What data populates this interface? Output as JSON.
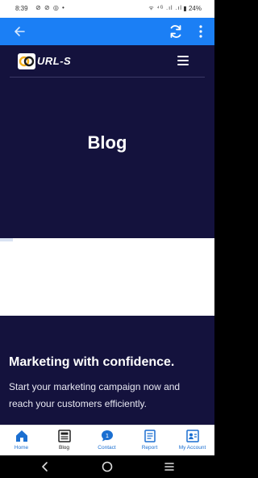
{
  "status_bar": {
    "time": "8:39",
    "left_icons": "⊘ ⊘ ◎ •",
    "right_icons": "ᯤ ⁴ᴳ .ıl .ıl",
    "battery": "▮ 24%"
  },
  "app_bar": {
    "accent": "#1b7ff5",
    "icons": [
      "arrow-left-icon",
      "refresh-icon",
      "more-vertical-icon"
    ]
  },
  "site": {
    "logo_text": "URL-S",
    "hero_title": "Blog",
    "promo": {
      "heading": "Marketing with confidence.",
      "text": "Start your marketing campaign now and reach your customers efficiently."
    },
    "background": "#14123d"
  },
  "bottom_nav": {
    "items": [
      {
        "label": "Home",
        "icon": "home-icon"
      },
      {
        "label": "Blog",
        "icon": "blog-icon"
      },
      {
        "label": "Contact",
        "icon": "contact-icon",
        "badge": "1"
      },
      {
        "label": "Report",
        "icon": "report-icon"
      },
      {
        "label": "My Account",
        "icon": "account-icon"
      }
    ]
  },
  "android_nav": {
    "icons": [
      "back-icon",
      "home-circle-icon",
      "recents-icon"
    ]
  }
}
